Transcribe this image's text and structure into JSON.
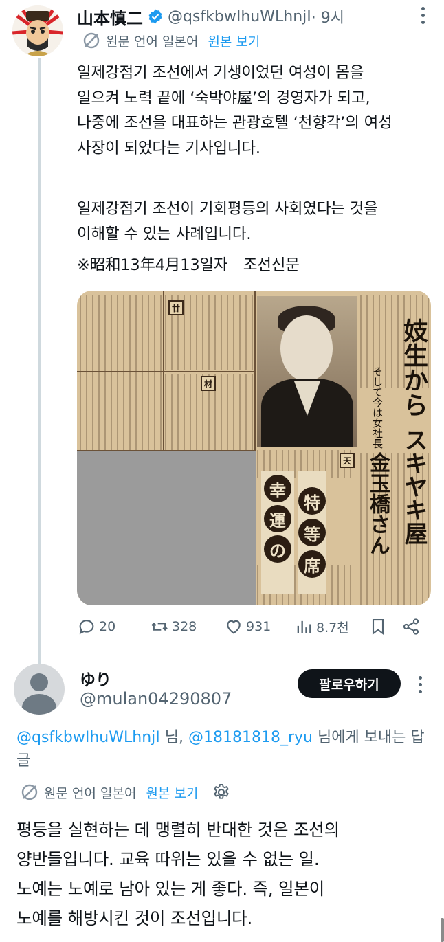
{
  "tweet": {
    "author_name": "山本慎二",
    "author_handle": "@qsfkbwIhuWLhnjI",
    "time": " · 9시",
    "translate": {
      "text": "원문 언어 일본어",
      "link": "원본 보기"
    },
    "body_p1": "일제강점기 조선에서 기생이었던 여성이 몸을\n일으켜 노력 끝에 ‘숙박야屋’의 경영자가 되고,\n나중에 조선을 대표하는 관광호텔 ‘천향각’의 여성\n사장이 되었다는 기사입니다.",
    "body_p2": "일제강점기 조선이 기회평등의 사회였다는 것을\n이해할 수 있는 사례입니다.",
    "body_p3": "※昭和13年4月13일자　조선신문",
    "image": {
      "headline_1": "妓生から",
      "headline_2": "スキヤキ屋",
      "subhead": "そして今は女社長",
      "name": "金玉橋さん",
      "side_title": "幸運の特等席",
      "tags": [
        "廿",
        "材",
        "自",
        "天"
      ]
    },
    "stats": {
      "replies": "20",
      "retweets": "328",
      "likes": "931",
      "views": "8.7천"
    }
  },
  "reply": {
    "author_name": "ゆり",
    "author_handle": "@mulan04290807",
    "follow_label": "팔로우하기",
    "replying_mention_1": "@qsfkbwIhuWLhnjI",
    "replying_sep_1": " 님, ",
    "replying_mention_2": "@18181818_ryu",
    "replying_tail": " 님에게 보내는 답글",
    "translate": {
      "text": "원문 언어 일본어",
      "link": "원본 보기"
    },
    "body": "평등을 실현하는 데 맹렬히 반대한 것은 조선의\n양반들입니다. 교육 따위는 있을 수 없는 일.\n노예는 노예로 남아 있는 게 좋다. 즉, 일본이\n노예를 해방시킨 것이 조선입니다."
  },
  "colors": {
    "accent": "#1d9bf0",
    "text": "#0f1419",
    "muted": "#536471"
  }
}
